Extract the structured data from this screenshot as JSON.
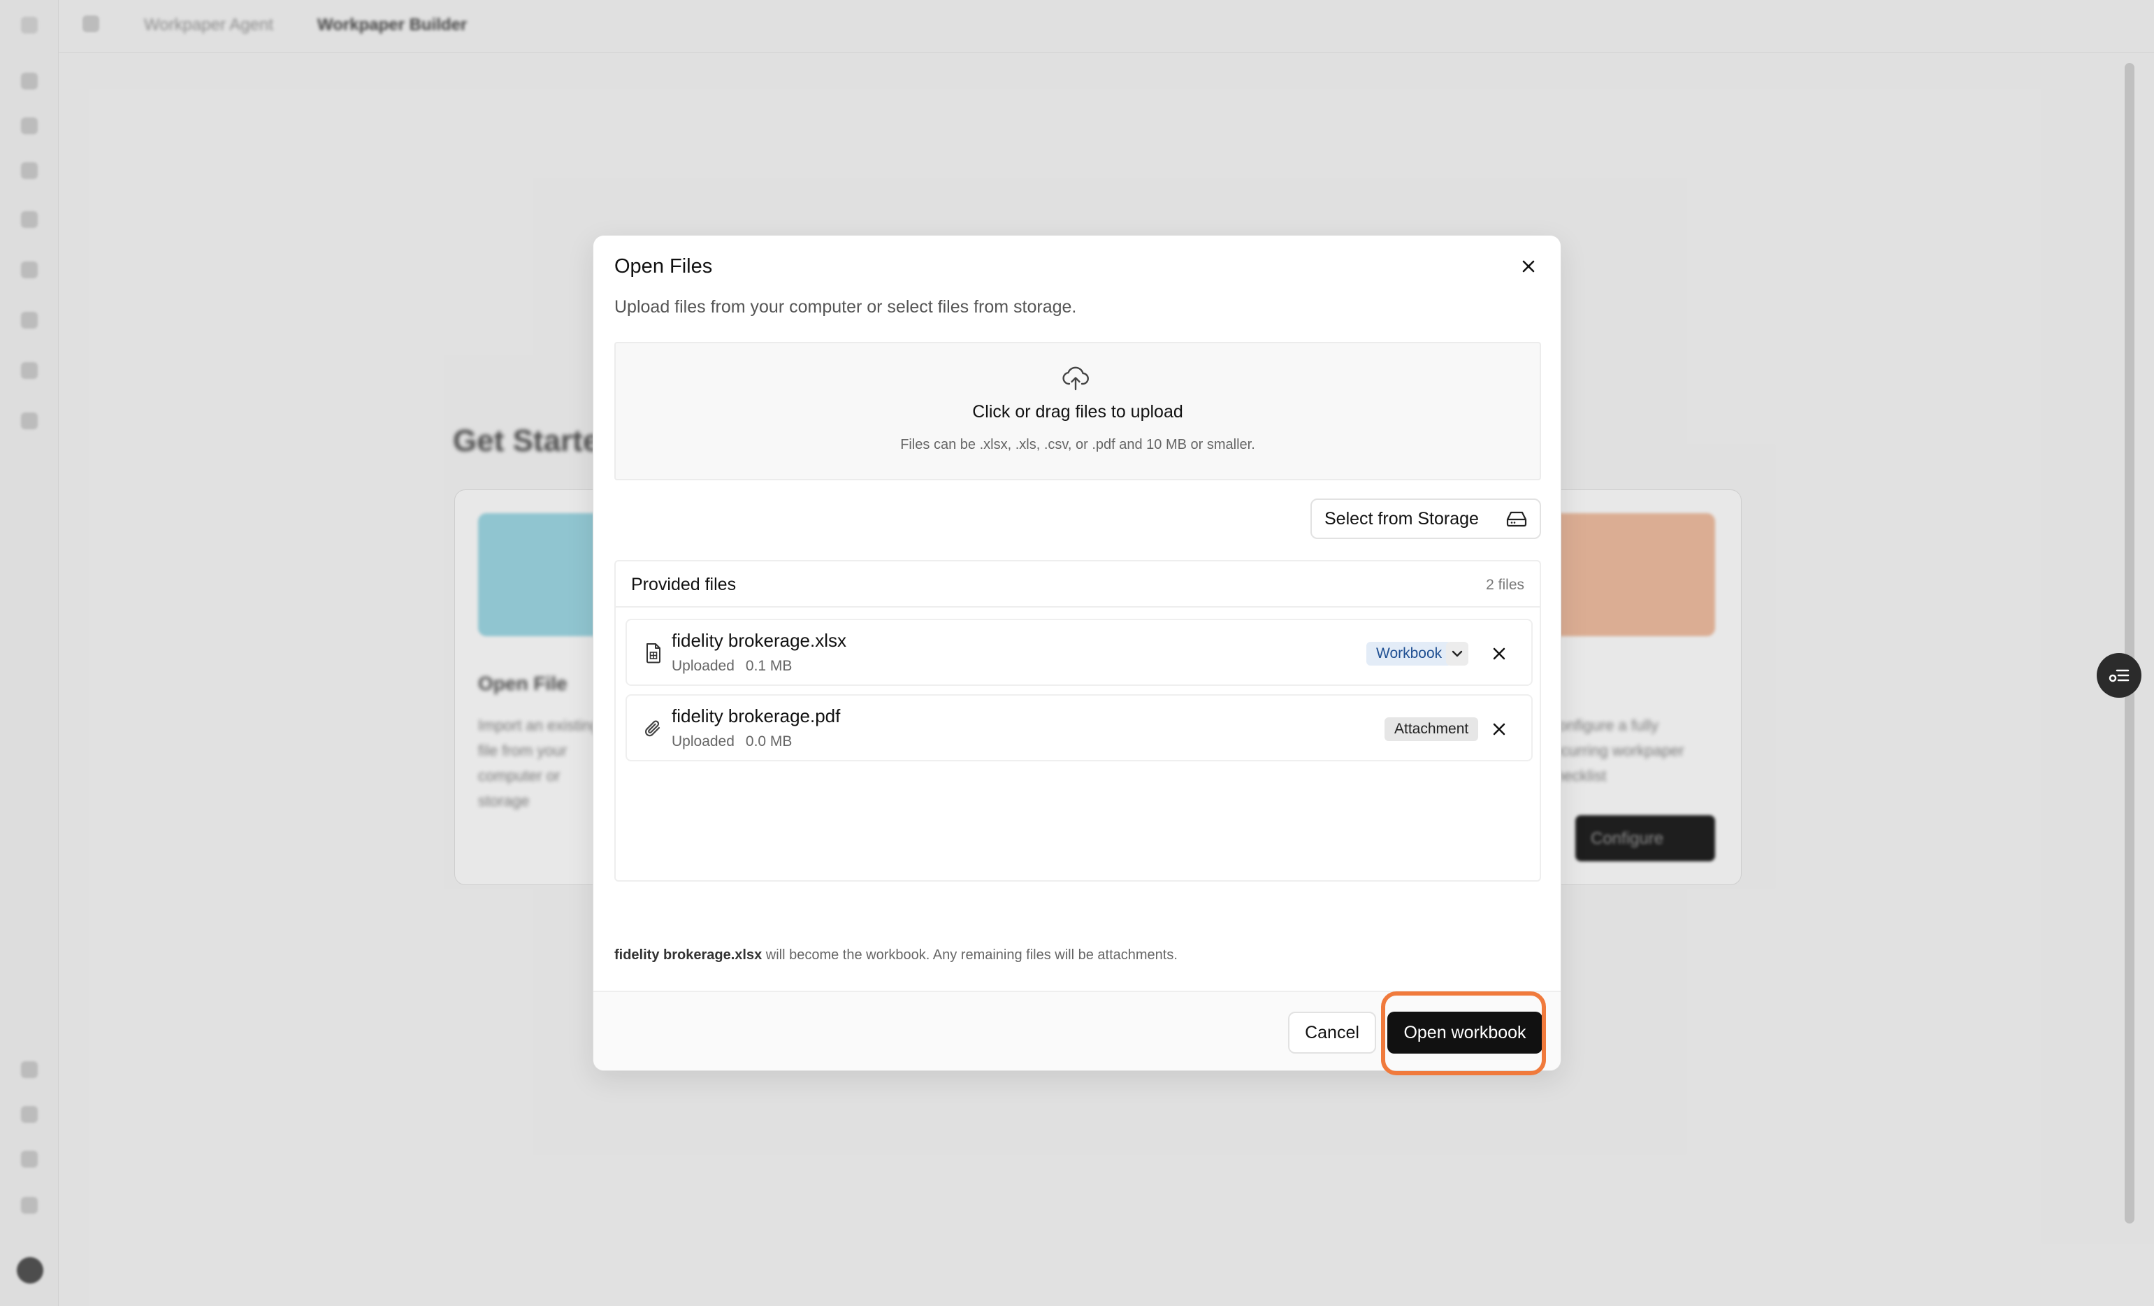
{
  "breadcrumb": {
    "parent": "Workpaper Agent",
    "current": "Workpaper Builder"
  },
  "background": {
    "heading": "Get Started",
    "card_left_title": "Open File",
    "card_left_desc": "Import an existing file from your computer or storage",
    "card_right_desc": "Configure a fully recurring workpaper checklist",
    "card_right_button": "Configure"
  },
  "modal": {
    "title": "Open Files",
    "description": "Upload files from your computer or select files from storage.",
    "dropzone": {
      "icon": "cloud-upload-icon",
      "title": "Click or drag files to upload",
      "subtitle": "Files can be .xlsx, .xls, .csv, or .pdf and 10 MB or smaller."
    },
    "storage_button": "Select from Storage",
    "files_panel": {
      "title": "Provided files",
      "count": "2 files",
      "files": [
        {
          "name": "fidelity brokerage.xlsx",
          "status": "Uploaded",
          "size": "0.1 MB",
          "role": "Workbook",
          "icon": "spreadsheet-file-icon"
        },
        {
          "name": "fidelity brokerage.pdf",
          "status": "Uploaded",
          "size": "0.0 MB",
          "role": "Attachment",
          "icon": "paperclip-icon"
        }
      ]
    },
    "note_filename": "fidelity brokerage.xlsx",
    "note_text": " will become the workbook. Any remaining files will be attachments.",
    "cancel_label": "Cancel",
    "open_label": "Open workbook"
  },
  "colors": {
    "highlight": "#f07a3c",
    "primary_button": "#111111",
    "workbook_badge_bg": "#e3ecf7",
    "workbook_badge_text": "#1f4f92"
  }
}
